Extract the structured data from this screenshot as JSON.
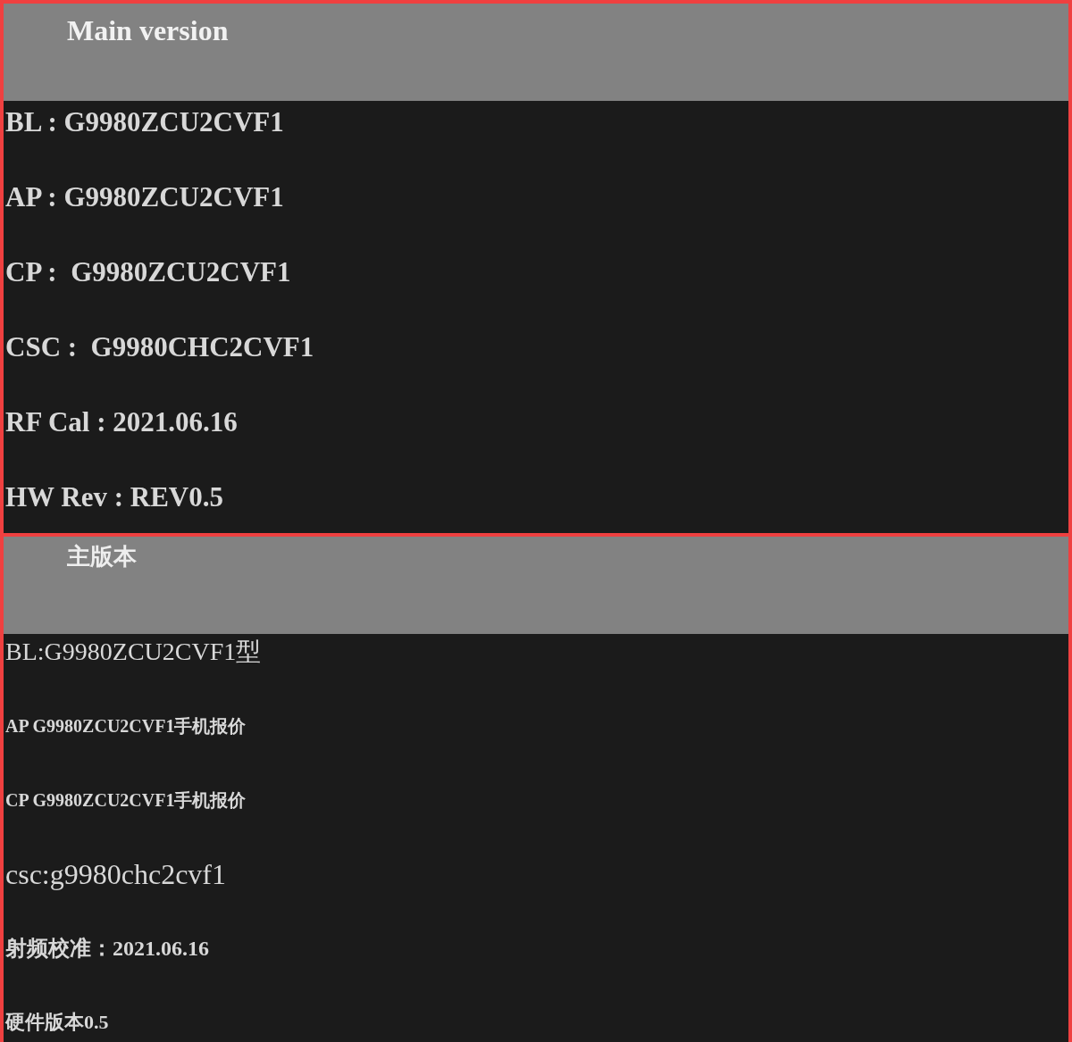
{
  "panels": [
    {
      "title": "Main version",
      "rows": [
        "BL : G9980ZCU2CVF1",
        "AP : G9980ZCU2CVF1",
        "CP :  G9980ZCU2CVF1",
        "CSC :  G9980CHC2CVF1",
        "RF Cal : 2021.06.16",
        "HW Rev : REV0.5"
      ]
    },
    {
      "title": "主版本",
      "rows": [
        "BL:G9980ZCU2CVF1型",
        "AP G9980ZCU2CVF1手机报价",
        "CP G9980ZCU2CVF1手机报价",
        "csc:g9980chc2cvf1",
        "射频校准：2021.06.16",
        "硬件版本0.5"
      ]
    }
  ]
}
